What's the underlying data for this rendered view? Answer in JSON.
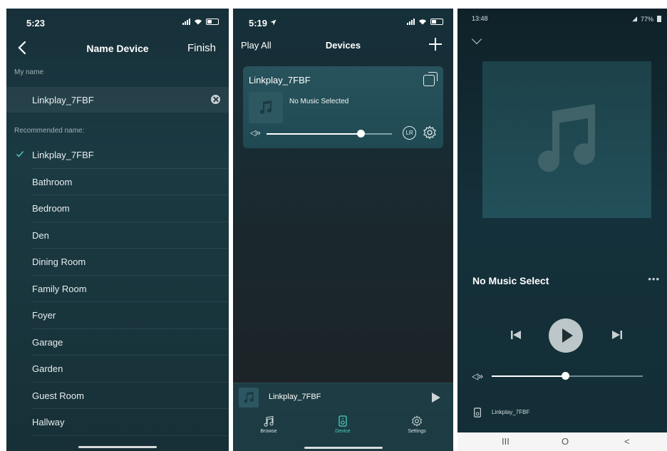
{
  "screen1": {
    "status_time": "5:23",
    "nav": {
      "back": "<",
      "title": "Name Device",
      "finish": "Finish"
    },
    "my_name_label": "My name",
    "name_value": "Linkplay_7FBF",
    "recommended_label": "Recommended name:",
    "recommended": [
      {
        "label": "Linkplay_7FBF",
        "selected": true
      },
      {
        "label": "Bathroom",
        "selected": false
      },
      {
        "label": "Bedroom",
        "selected": false
      },
      {
        "label": "Den",
        "selected": false
      },
      {
        "label": "Dining Room",
        "selected": false
      },
      {
        "label": "Family Room",
        "selected": false
      },
      {
        "label": "Foyer",
        "selected": false
      },
      {
        "label": "Garage",
        "selected": false
      },
      {
        "label": "Garden",
        "selected": false
      },
      {
        "label": "Guest Room",
        "selected": false
      },
      {
        "label": "Hallway",
        "selected": false
      }
    ]
  },
  "screen2": {
    "status_time": "5:19",
    "nav": {
      "left": "Play All",
      "title": "Devices"
    },
    "device": {
      "name": "Linkplay_7FBF",
      "now_playing": "No Music Selected",
      "volume_fraction": 0.75,
      "channel_badge": "LR"
    },
    "mini_player": {
      "name": "Linkplay_7FBF"
    },
    "tabs": [
      {
        "label": "Browse",
        "icon": "music-note-icon"
      },
      {
        "label": "Device",
        "icon": "speaker-icon"
      },
      {
        "label": "Settings",
        "icon": "gear-icon"
      }
    ]
  },
  "screen3": {
    "status_time": "13:48",
    "status_battery": "77%",
    "title": "No Music Select",
    "volume_fraction": 0.49,
    "device_name": "Linkplay_7FBF",
    "android_nav": {
      "recents": "III",
      "home": "O",
      "back": "<"
    }
  }
}
